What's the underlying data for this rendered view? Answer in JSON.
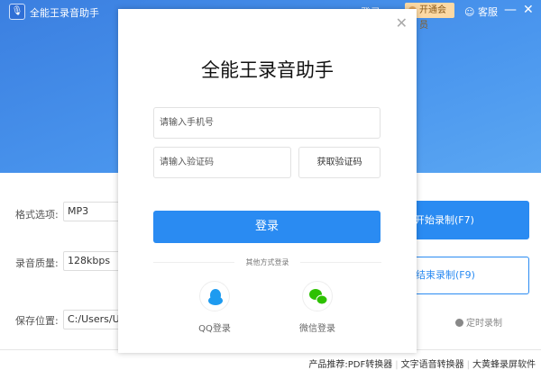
{
  "app": {
    "title": "全能王录音助手",
    "login": "登录",
    "vip": "开通会员",
    "service": "客服"
  },
  "form": {
    "format_label": "格式选项:",
    "format_value": "MP3",
    "quality_label": "录音质量:",
    "quality_value": "128kbps",
    "save_label": "保存位置:",
    "save_value": "C:/Users/Use"
  },
  "actions": {
    "start": "开始录制(F7)",
    "stop": "结束录制(F9)",
    "timer": "定时录制"
  },
  "footer": {
    "prefix": "产品推荐:",
    "items": [
      "PDF转换器",
      "文字语音转换器",
      "大黄蜂录屏软件"
    ]
  },
  "modal": {
    "title": "全能王录音助手",
    "phone_placeholder": "请输入手机号",
    "code_placeholder": "请输入验证码",
    "get_code": "获取验证码",
    "login": "登录",
    "other": "其他方式登录",
    "qq": "QQ登录",
    "wechat": "微信登录"
  },
  "colors": {
    "primary": "#2a8bf2",
    "qq": "#1e9bf0",
    "wechat": "#2dc100",
    "vip": "#fcd9a4"
  }
}
